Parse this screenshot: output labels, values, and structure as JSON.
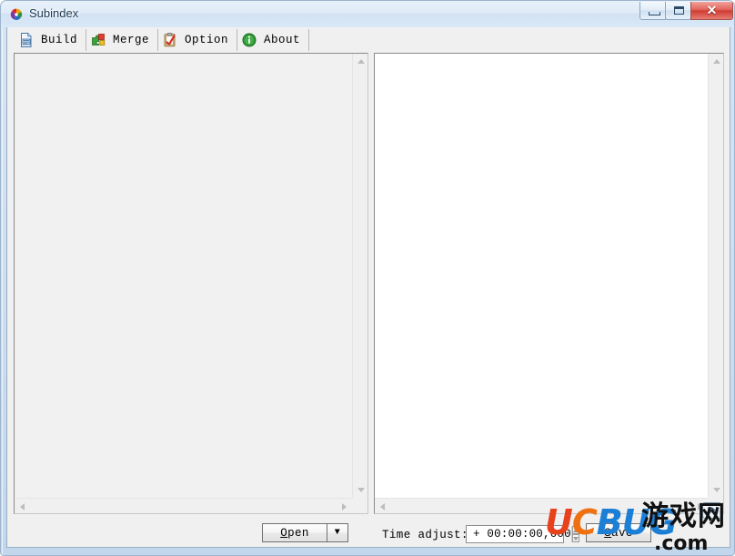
{
  "window": {
    "title": "Subindex",
    "icon": "app-pinwheel-icon",
    "controls": {
      "minimize": "minimize-button",
      "maximize": "maximize-button",
      "close_glyph": "✕"
    }
  },
  "toolbar": {
    "items": [
      {
        "label": "Build",
        "icon": "build-document-icon"
      },
      {
        "label": "Merge",
        "icon": "merge-puzzle-icon"
      },
      {
        "label": "Option",
        "icon": "option-clipboard-icon"
      },
      {
        "label": "About",
        "icon": "about-info-icon"
      }
    ]
  },
  "panels": {
    "left": {
      "name": "source-subtitle-list",
      "content": "",
      "enabled": false,
      "background": "#f1f1f1"
    },
    "right": {
      "name": "output-preview",
      "content": "",
      "enabled": true,
      "background": "#ffffff"
    }
  },
  "bottom": {
    "open_button": {
      "label": "Open",
      "accelerator": "O"
    },
    "open_dropdown_glyph": "▼",
    "time_adjust_label": "Time adjust:",
    "time_adjust_accelerator": "T",
    "time_adjust_value": "+ 00:00:00,000",
    "save_button": {
      "label": "Save",
      "accelerator": "S"
    },
    "collapse_button_glyph": "⌃"
  },
  "watermark": {
    "part_u": "U",
    "part_c": "C",
    "part_bug": "BUG",
    "part_cn": "游戏网",
    "part_com": ".com"
  },
  "colors": {
    "titlebar_top": "#e8f1fa",
    "titlebar_bottom": "#d9e8f7",
    "frame": "#c3d7ec",
    "client_bg": "#f0f0f0",
    "panel_left_bg": "#f1f1f1",
    "panel_right_bg": "#ffffff",
    "close_button": "#cf3c33",
    "watermark_red": "#e8421c",
    "watermark_blue": "#1c7fd6"
  }
}
